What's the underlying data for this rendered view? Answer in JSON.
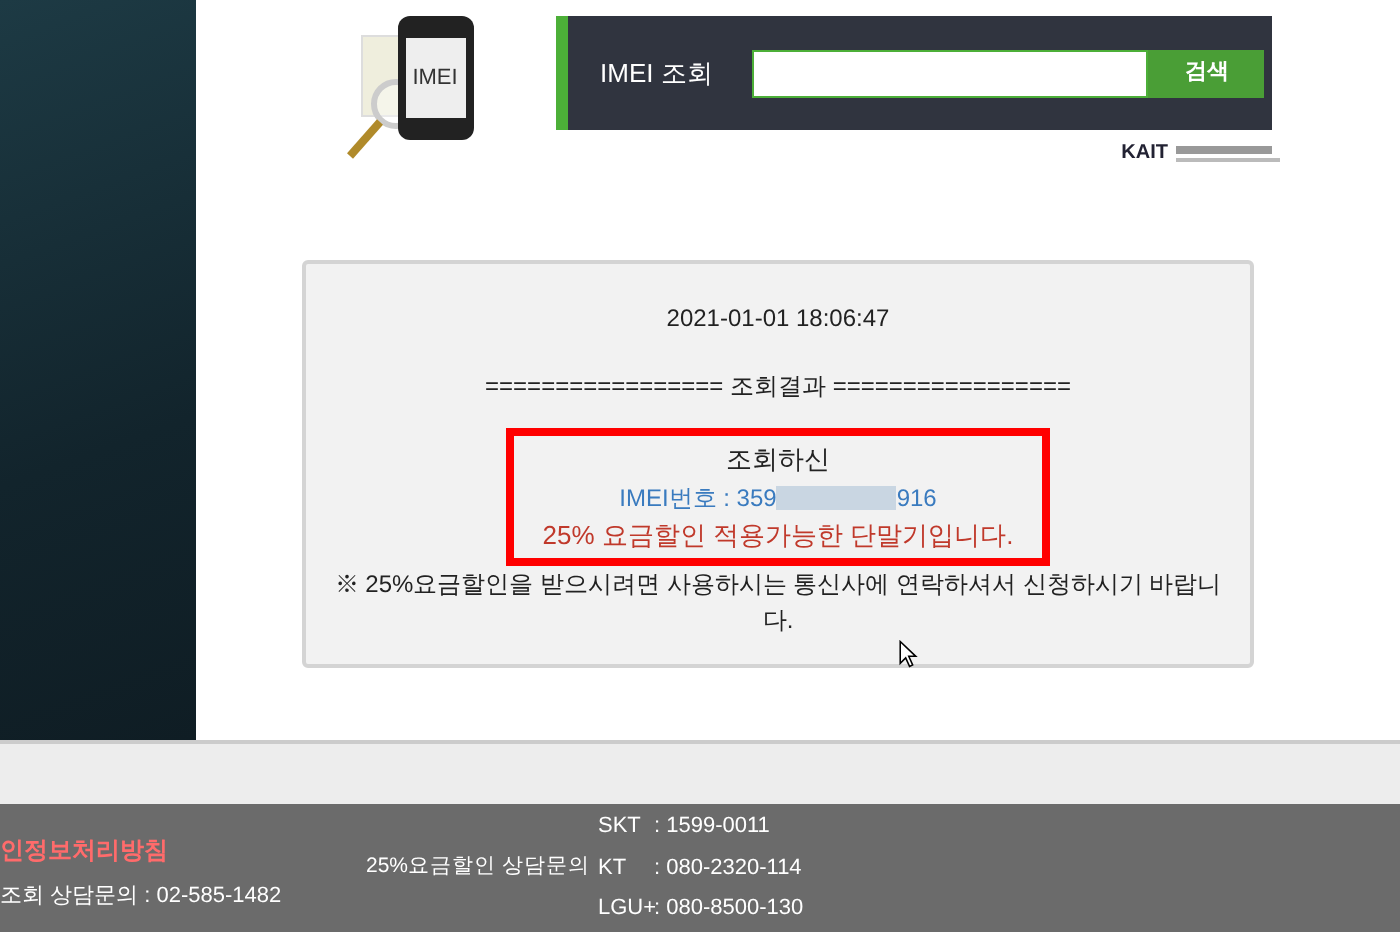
{
  "header": {
    "logo_text": "IMEI",
    "search": {
      "label": "IMEI 조회",
      "button": "검색"
    },
    "partner_logo": "KAIT"
  },
  "result": {
    "timestamp": "2021-01-01 18:06:47",
    "divider": "================= 조회결과 =================",
    "highlighted": true,
    "lines": [
      {
        "kind": "plain",
        "text": "조회하신"
      },
      {
        "kind": "imei",
        "prefix": "IMEI번호 : 359",
        "suffix": "916"
      },
      {
        "kind": "alert",
        "text": "25% 요금할인 적용가능한 단말기입니다."
      }
    ],
    "note": "※ 25%요금할인을 받으시려면 사용하시는 통신사에 연락하셔서 신청하시기 바랍니다."
  },
  "footer": {
    "privacy_link": "인정보처리방침",
    "inquiry": "조회 상담문의 : 02-585-1482",
    "discount_label": "25%요금할인 상담문의",
    "carriers": [
      {
        "name": "SKT",
        "number": ": 1599-0011"
      },
      {
        "name": "KT",
        "number": ": 080-2320-114"
      },
      {
        "name": "LGU+",
        "number": ": 080-8500-130"
      }
    ]
  }
}
